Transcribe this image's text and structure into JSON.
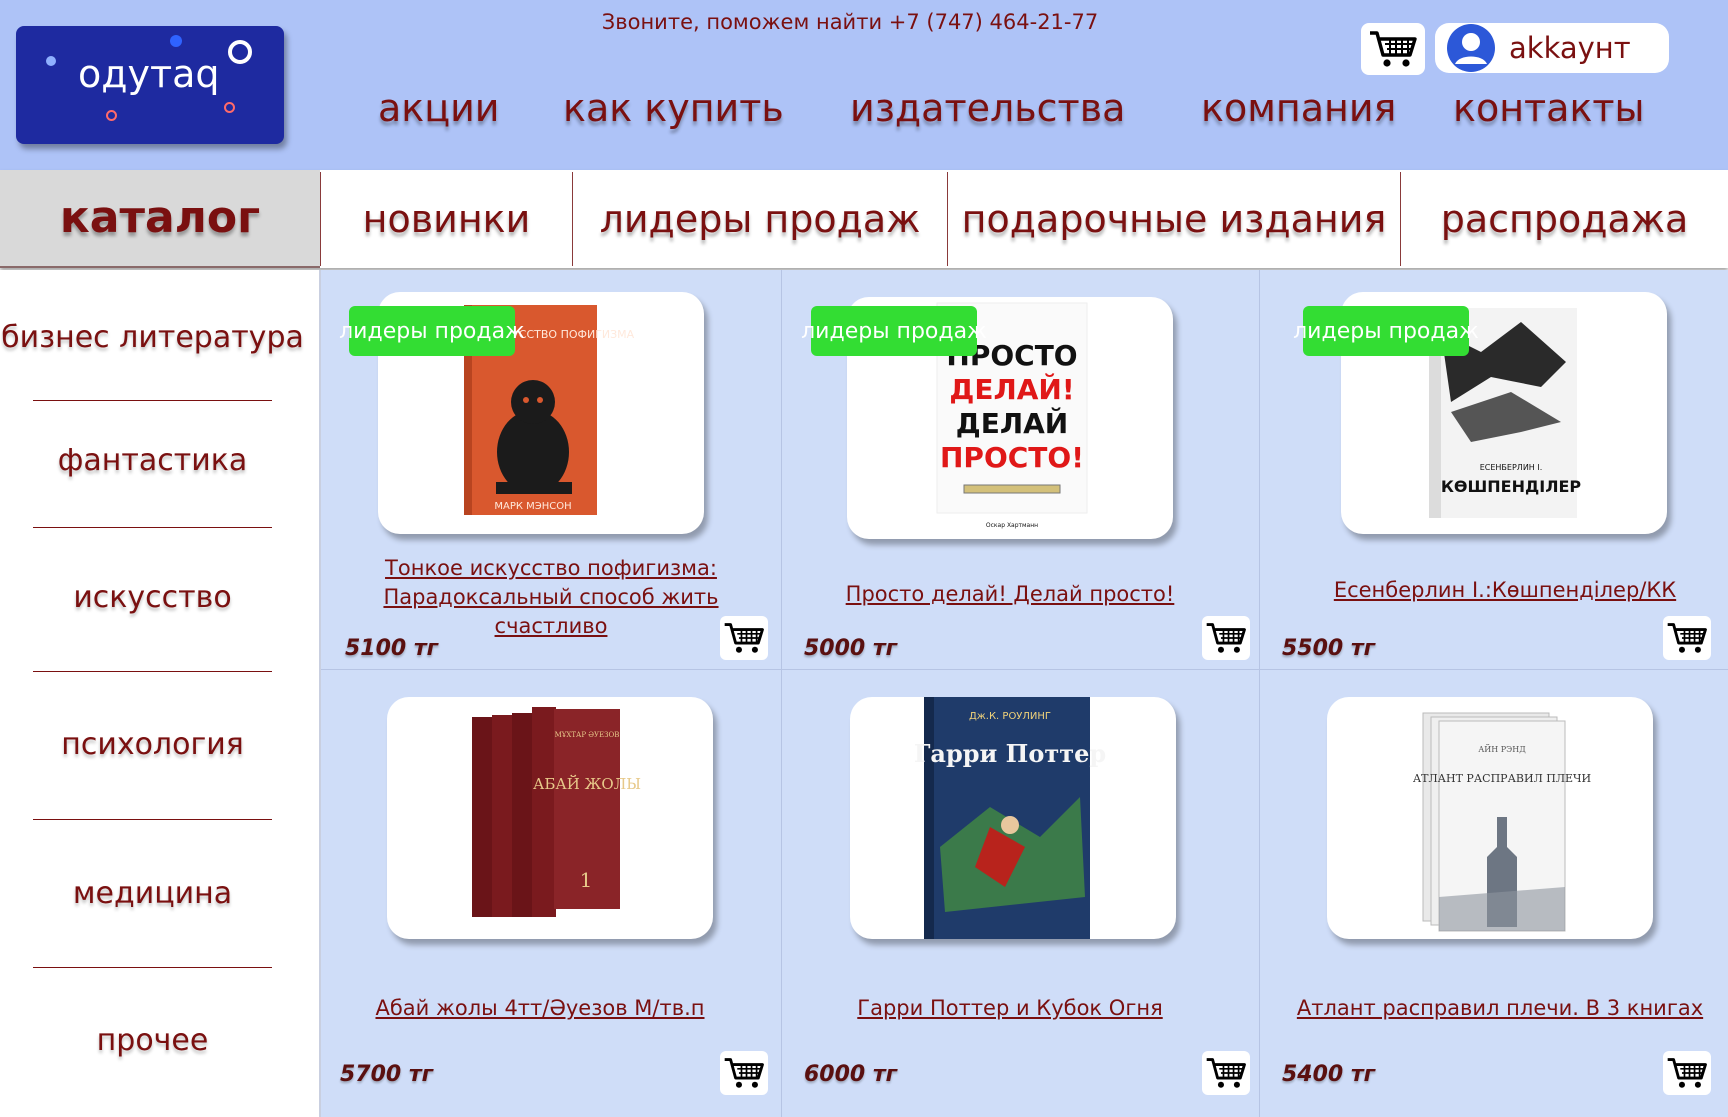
{
  "header": {
    "logo_text": "одутаq",
    "phone_text": "Звоните, поможем найти +7 (747) 464-21-77",
    "account_label": "akkaунт",
    "cart_icon": "cart-icon",
    "nav": [
      "акции",
      "как купить",
      "издательства",
      "компания",
      "контакты"
    ]
  },
  "category_bar": {
    "catalog_label": "каталог",
    "tabs": [
      "новинки",
      "лидеры продаж",
      "подарочные издания",
      "распродажа"
    ]
  },
  "sidebar": {
    "items": [
      "бизнес литература",
      "фантастика",
      "искусство",
      "психология",
      "медицина",
      "прочее"
    ]
  },
  "products": [
    {
      "badge": "лидеры продаж",
      "title": "Тонкое искусство пофигизма: Парадоксальный способ жить счастливо",
      "price": "5100 тг",
      "cover_title": "ТОНКОЕ ИСКУССТВО ПОФИГИЗМА",
      "cover_author": "МАРК МЭНСОН"
    },
    {
      "badge": "лидеры продаж",
      "title": "Просто делай! Делай просто!",
      "price": "5000 тг",
      "cover_lines": [
        "ПРОСТО",
        "ДЕЛАЙ!",
        "ДЕЛАЙ",
        "ПРОСТО!"
      ],
      "cover_author": "Оскар Хартманн"
    },
    {
      "badge": "лидеры продаж",
      "title": "Есенберлин І.:Көшпенділер/КК",
      "price": "5500 тг",
      "cover_title": "КӨШПЕНДІЛЕР",
      "cover_author": "ЕСЕНБЕРЛИН І."
    },
    {
      "badge": "",
      "title": "Абай жолы 4тт/Әуезов М/тв.п",
      "price": "5700 тг",
      "cover_title": "АБАЙ ЖОЛЫ",
      "cover_author": "МҰХТАР ӘУЕЗОВ"
    },
    {
      "badge": "",
      "title": "Гарри Поттер и Кубок Огня",
      "price": "6000 тг",
      "cover_title": "Гарри Поттер",
      "cover_author": "Дж.К. РОУЛИНГ"
    },
    {
      "badge": "",
      "title": "Атлант расправил плечи. В 3 книгах",
      "price": "5400 тг",
      "cover_title": "АТЛАНТ РАСПРАВИЛ ПЛЕЧИ",
      "cover_author": "АЙН РЭНД"
    }
  ],
  "colors": {
    "header_bg": "#aec3f7",
    "grid_bg": "#cfddf8",
    "text_accent": "#7a1010",
    "badge_green": "#33dd33",
    "logo_bg": "#1e2aa0"
  }
}
